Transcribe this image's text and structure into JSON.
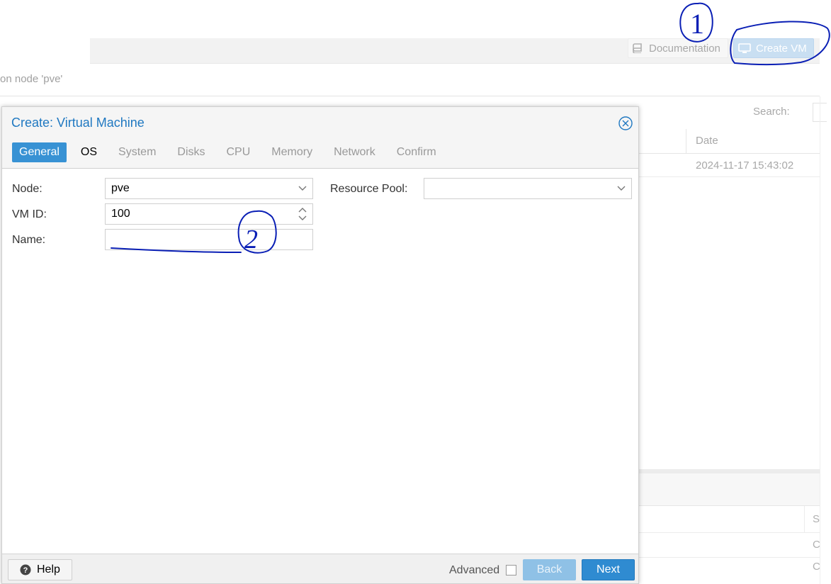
{
  "header": {
    "documentation_label": "Documentation",
    "create_vm_label": "Create VM"
  },
  "content": {
    "heading": "on node 'pve'",
    "search_label": "Search:",
    "grid": {
      "date_header": "Date",
      "rows": [
        {
          "date": "2024-11-17 15:43:02"
        }
      ]
    },
    "lower_grid": {
      "col_partial": "S",
      "cells_partial": [
        "C",
        "C"
      ]
    }
  },
  "dialog": {
    "title": "Create: Virtual Machine",
    "tabs": [
      {
        "label": "General",
        "state": "active"
      },
      {
        "label": "OS",
        "state": "enabled"
      },
      {
        "label": "System",
        "state": "disabled"
      },
      {
        "label": "Disks",
        "state": "disabled"
      },
      {
        "label": "CPU",
        "state": "disabled"
      },
      {
        "label": "Memory",
        "state": "disabled"
      },
      {
        "label": "Network",
        "state": "disabled"
      },
      {
        "label": "Confirm",
        "state": "disabled"
      }
    ],
    "form": {
      "node_label": "Node:",
      "node_value": "pve",
      "vmid_label": "VM ID:",
      "vmid_value": "100",
      "name_label": "Name:",
      "name_value": "",
      "resource_pool_label": "Resource Pool:",
      "resource_pool_value": ""
    },
    "footer": {
      "help_label": "Help",
      "advanced_label": "Advanced",
      "advanced_checked": false,
      "back_label": "Back",
      "next_label": "Next"
    }
  },
  "annotations": {
    "marks": [
      "1",
      "2"
    ],
    "ink_color": "#0a1fb5"
  },
  "colors": {
    "accent": "#3892d4",
    "title": "#1f78c1",
    "disabled_button": "#8fc1e6"
  }
}
